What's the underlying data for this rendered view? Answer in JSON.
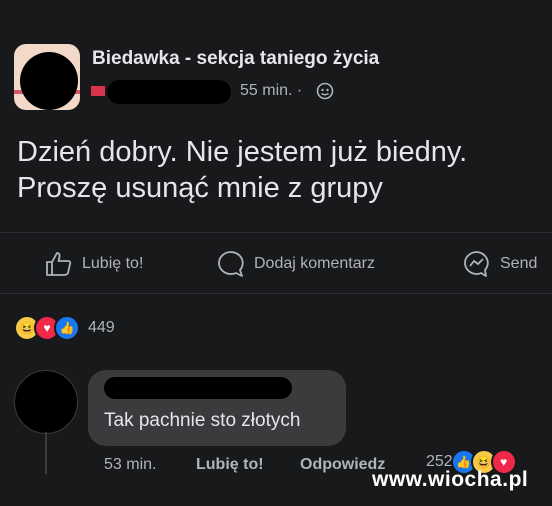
{
  "post": {
    "group_name": "Biedawka - sekcja taniego życia",
    "time": "55 min. ·",
    "text_line1": "Dzień dobry. Nie jestem już biedny.",
    "text_line2": "Proszę usunąć mnie z grupy"
  },
  "actions": {
    "like": "Lubię to!",
    "comment": "Dodaj komentarz",
    "send": "Send"
  },
  "post_reactions": {
    "count": "449",
    "types": [
      "haha",
      "love",
      "like"
    ]
  },
  "comment": {
    "text": "Tak pachnie sto złotych",
    "time": "53 min.",
    "like": "Lubię to!",
    "reply": "Odpowiedz",
    "reaction_count": "252",
    "reaction_types": [
      "like",
      "haha",
      "love"
    ]
  },
  "watermark": "www.wiocha.pl",
  "colors": {
    "background": "#18191b",
    "bubble": "#3a3b3c",
    "text": "#e4e6eb",
    "muted": "#b0b3b8",
    "like_blue": "#1877f2",
    "love_red": "#f0284a",
    "haha_yellow": "#f7c948"
  },
  "icons": [
    "like-icon",
    "comment-icon",
    "messenger-icon",
    "globe-icon"
  ]
}
